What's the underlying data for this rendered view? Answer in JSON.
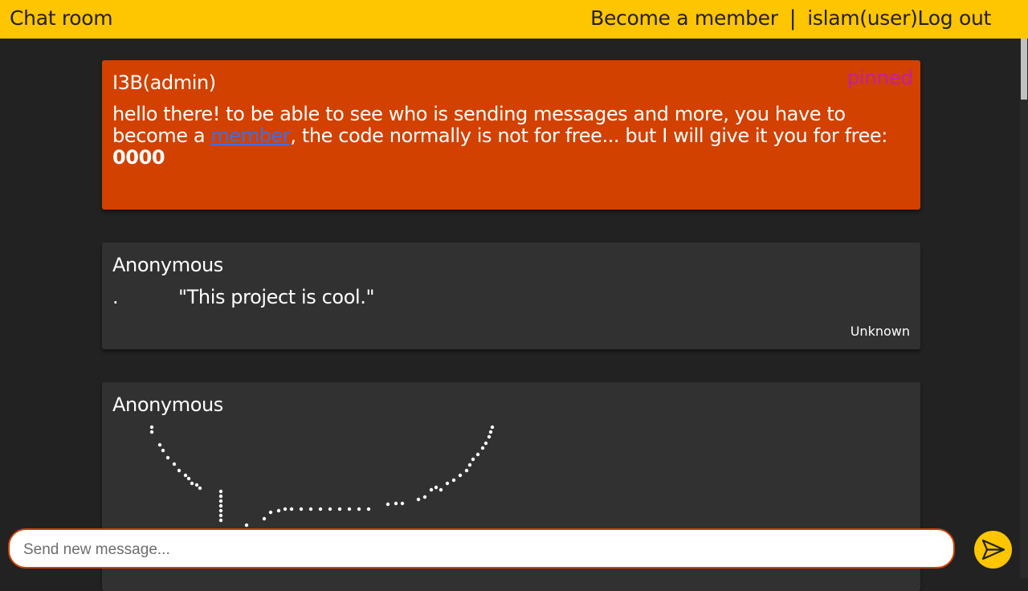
{
  "header": {
    "title": "Chat room",
    "become_member": "Become a member",
    "separator": "|",
    "user": "islam(user)",
    "logout": "Log out"
  },
  "messages": [
    {
      "author": "I3B(admin)",
      "badge": "pinned",
      "text_before": "hello there! to be able to see who is sending messages and more, you have to become a ",
      "link_text": "member",
      "text_after": ", the code normally is not for free... but I will give it you for free:",
      "code": "0000"
    },
    {
      "author": "Anonymous",
      "prefix": ".",
      "quote": "\"This project is cool.\"",
      "footer": "Unknown"
    },
    {
      "author": "Anonymous",
      "art": "dot-art-drawing"
    }
  ],
  "composer": {
    "placeholder": "Send new message..."
  },
  "icons": {
    "send": "send-arrow-icon"
  },
  "colors": {
    "header": "#fec501",
    "pinned_bg": "#d24100",
    "card_bg": "#313131",
    "page_bg": "#222222",
    "pinned_badge": "#c41ea6",
    "link": "#3f6ee6"
  }
}
